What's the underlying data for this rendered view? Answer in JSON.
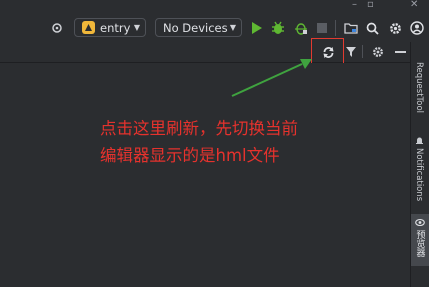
{
  "toolbar": {
    "config_label": "entry",
    "device_label": "No Devices"
  },
  "sidebar": {
    "items": [
      {
        "label": "RequestTool"
      },
      {
        "label": "Notifications"
      },
      {
        "label": "预览器"
      }
    ]
  },
  "annotation": {
    "text": "点击这里刷新，先切换当前\n编辑器显示的是hml文件"
  },
  "colors": {
    "background": "#2b2d30",
    "annotation": "#e6322d",
    "arrow": "#3fa33f",
    "run_green": "#5fb832"
  }
}
